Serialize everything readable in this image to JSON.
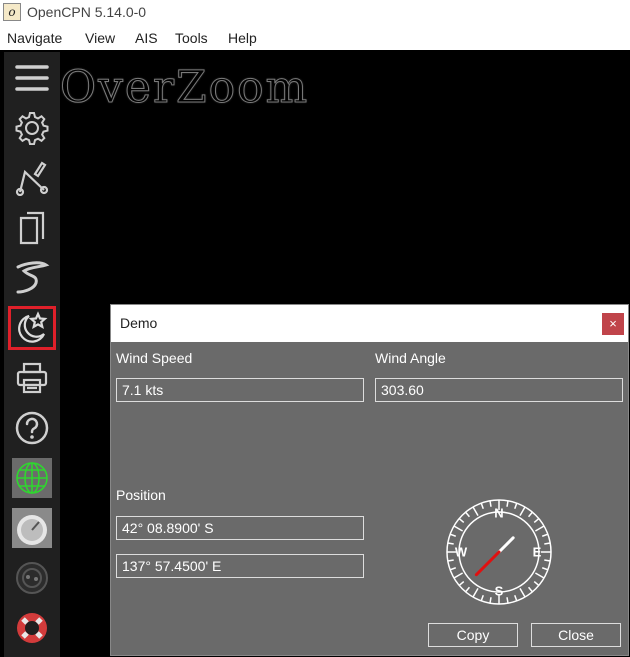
{
  "window": {
    "title": "OpenCPN 5.14.0-0",
    "icon_glyph": "o"
  },
  "menu": {
    "items": [
      "Navigate",
      "View",
      "AIS",
      "Tools",
      "Help"
    ]
  },
  "chart": {
    "overzoom_label": "OverZoom"
  },
  "toolbar": {
    "buttons": [
      {
        "name": "menu-hamburger-icon"
      },
      {
        "name": "settings-gear-icon"
      },
      {
        "name": "route-icon"
      },
      {
        "name": "route-manager-icon"
      },
      {
        "name": "track-icon"
      },
      {
        "name": "night-mode-icon",
        "selected": true
      },
      {
        "name": "print-icon"
      },
      {
        "name": "help-icon"
      },
      {
        "name": "globe-grid-icon"
      },
      {
        "name": "dashboard-gauge-icon"
      },
      {
        "name": "plugin-icon"
      },
      {
        "name": "lifebuoy-icon"
      }
    ]
  },
  "dialog": {
    "title": "Demo",
    "close_glyph": "×",
    "wind_speed_label": "Wind Speed",
    "wind_speed_value": "7.1 kts",
    "wind_angle_label": "Wind Angle",
    "wind_angle_value": "303.60",
    "position_label": "Position",
    "lat_value": "42° 08.8900' S",
    "lon_value": "137° 57.4500' E",
    "compass": {
      "n": "N",
      "e": "E",
      "s": "S",
      "w": "W",
      "needle_heading_deg": 45
    },
    "copy_label": "Copy",
    "close_label": "Close"
  },
  "colors": {
    "highlight": "#e0202a",
    "needle_north": "#ffffff",
    "needle_south": "#e01010"
  }
}
